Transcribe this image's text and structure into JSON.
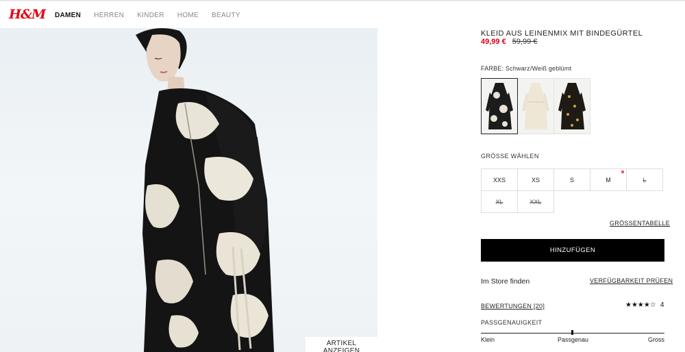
{
  "header": {
    "logo_text": "H&M",
    "nav": [
      {
        "label": "DAMEN",
        "active": true
      },
      {
        "label": "HERREN",
        "active": false
      },
      {
        "label": "KINDER",
        "active": false
      },
      {
        "label": "HOME",
        "active": false
      },
      {
        "label": "BEAUTY",
        "active": false
      }
    ]
  },
  "image": {
    "show_article_label": "ARTIKEL ANZEIGEN"
  },
  "product": {
    "title": "KLEID AUS LEINENMIX MIT BINDEGÜRTEL",
    "price_sale": "49,99 €",
    "price_old": "59,99 €",
    "color_label": "FARBE: Schwarz/Weiß geblümt",
    "swatches": [
      {
        "name": "Schwarz/Weiß geblümt",
        "selected": true
      },
      {
        "name": "Creme",
        "selected": false
      },
      {
        "name": "Schwarz geblümt",
        "selected": false
      }
    ],
    "size_label": "GRÖSSE WÄHLEN",
    "sizes_row1": [
      "XXS",
      "XS",
      "S",
      "M",
      "L"
    ],
    "sizes_row2": [
      "XL",
      "XXL"
    ],
    "size_chart_label": "GRÖSSENTABELLE",
    "add_label": "HINZUFÜGEN",
    "store_find_label": "Im Store finden",
    "availability_label": "VERFÜGBARKEIT PRÜFEN",
    "reviews_label": "BEWERTUNGEN [20]",
    "rating_value": "4",
    "rating_stars": "★★★★☆",
    "fit_label": "PASSGENAUIGKEIT",
    "fit_min": "Klein",
    "fit_mid": "Passgenau",
    "fit_max": "Gross"
  },
  "colors": {
    "brand": "#e50010",
    "sale": "#d6001c",
    "button_bg": "#000000"
  }
}
